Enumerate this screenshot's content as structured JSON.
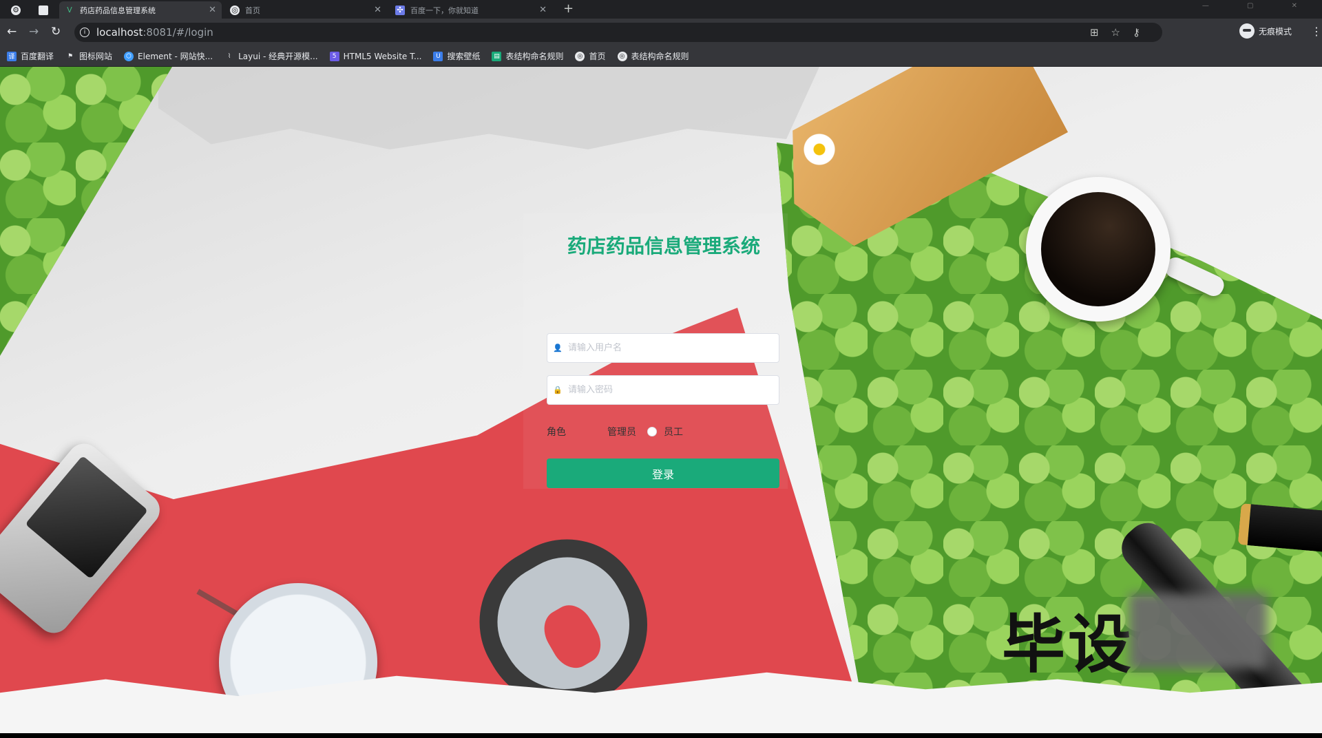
{
  "browser": {
    "tabs": [
      {
        "title": "药店药品信息管理系统",
        "icon": "vue-icon",
        "active": true
      },
      {
        "title": "首页",
        "icon": "globe-icon",
        "active": false
      },
      {
        "title": "百度一下，你就知道",
        "icon": "baidu-icon",
        "active": false
      }
    ],
    "url_host": "localhost",
    "url_rest": ":8081/#/login",
    "profile_label": "无痕模式",
    "bookmarks": [
      {
        "label": "百度翻译",
        "icon": "translate-icon",
        "color": "#3b7de9"
      },
      {
        "label": "图标网站",
        "icon": "flag-icon",
        "color": "#5f6368"
      },
      {
        "label": "Element - 网站快...",
        "icon": "element-icon",
        "color": "#409eff"
      },
      {
        "label": "Layui - 经典开源模...",
        "icon": "layui-icon",
        "color": "#5f6368"
      },
      {
        "label": "HTML5 Website T...",
        "icon": "html5-icon",
        "color": "#6c5ce7"
      },
      {
        "label": "搜索壁纸",
        "icon": "wallpaper-icon",
        "color": "#3b7de9"
      },
      {
        "label": "表结构命名规则",
        "icon": "doc-icon",
        "color": "#1aaa7a"
      },
      {
        "label": "首页",
        "icon": "globe-icon",
        "color": "#5f6368"
      },
      {
        "label": "表结构命名规则",
        "icon": "globe-icon",
        "color": "#5f6368"
      }
    ]
  },
  "login": {
    "title": "药店药品信息管理系统",
    "username_placeholder": "请输入用户名",
    "password_placeholder": "请输入密码",
    "role_label": "角色",
    "roles": [
      "管理员",
      "员工"
    ],
    "submit_label": "登录"
  },
  "watermark": "毕设",
  "colors": {
    "accent": "#1aaa7a",
    "red": "#e0484e"
  }
}
